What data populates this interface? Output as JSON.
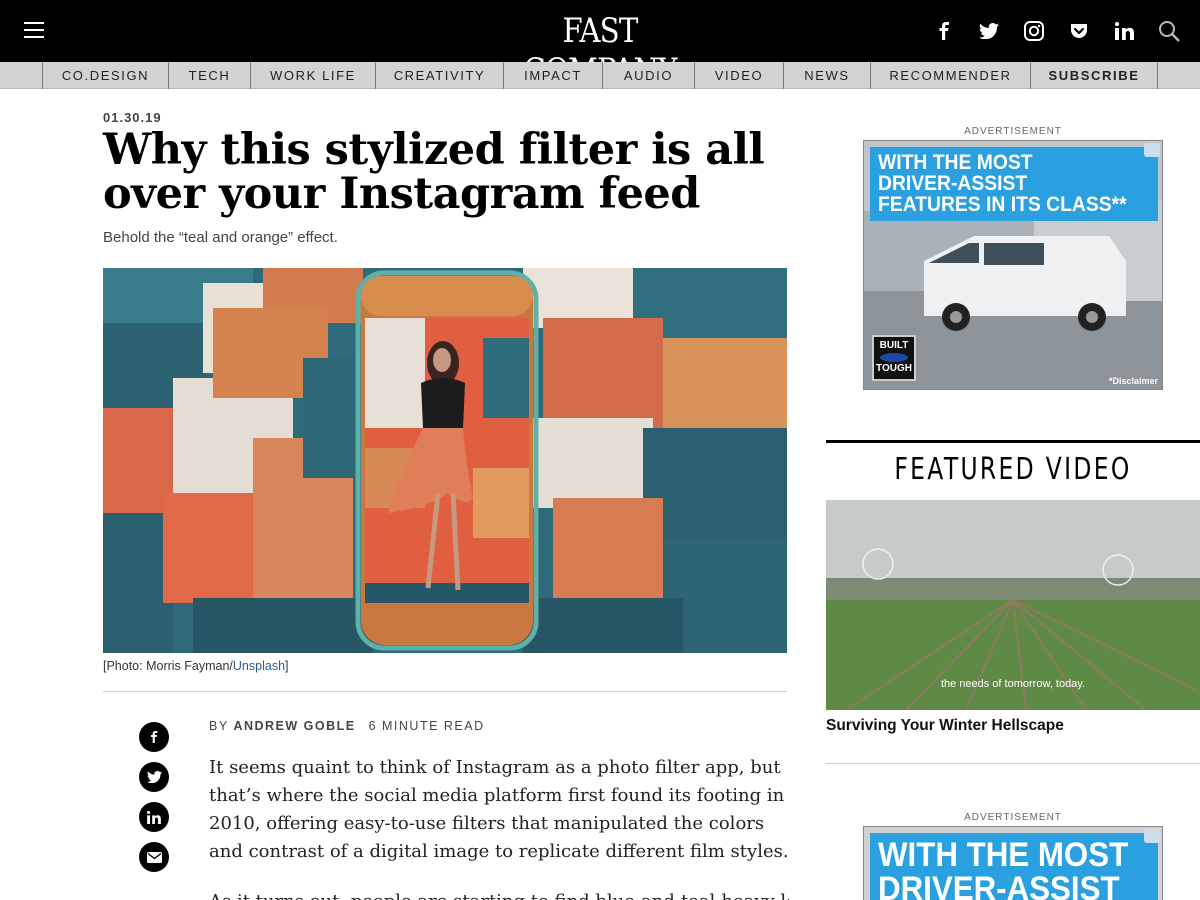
{
  "header": {
    "logo": "FAST COMPANY",
    "menu_icon": "hamburger-menu-icon",
    "social": [
      "facebook-icon",
      "twitter-icon",
      "instagram-icon",
      "pocket-icon",
      "linkedin-icon"
    ],
    "search_icon": "search-icon"
  },
  "nav": {
    "items": [
      {
        "label": "CO.DESIGN"
      },
      {
        "label": "TECH"
      },
      {
        "label": "WORK LIFE"
      },
      {
        "label": "CREATIVITY"
      },
      {
        "label": "IMPACT"
      },
      {
        "label": "AUDIO"
      },
      {
        "label": "VIDEO"
      },
      {
        "label": "NEWS"
      },
      {
        "label": "RECOMMENDER"
      },
      {
        "label": "SUBSCRIBE"
      }
    ]
  },
  "article": {
    "date": "01.30.19",
    "headline": "Why this stylized filter is all over your Instagram feed",
    "dek": "Behold the “teal and orange” effect.",
    "caption_prefix": "[Photo: Morris Fayman/",
    "caption_link": "Unsplash",
    "caption_suffix": "]",
    "byline_prefix": "BY",
    "author": "ANDREW GOBLE",
    "read_time": "6 MINUTE READ",
    "paragraph1": "It seems quaint to think of Instagram as a photo filter app, but that’s where the social media platform first found its footing in 2010, offering easy-to-use filters that manipulated the colors and contrast of a digital image to replicate different film styles.",
    "paragraph2": "As it turns out, people are starting to find blue-and-teal-heavy look"
  },
  "share": [
    "facebook-icon",
    "twitter-icon",
    "linkedin-icon",
    "email-icon"
  ],
  "sidebar": {
    "ad_label": "ADVERTISEMENT",
    "ad": {
      "line1": "WITH THE MOST",
      "line2": "DRIVER-ASSIST",
      "line3": "FEATURES IN ITS CLASS**",
      "badge_top": "BUILT",
      "badge_bottom": "TOUGH",
      "disclaimer": "*Disclaimer"
    },
    "featured_video": {
      "title": "FEATURED VIDEO",
      "subtitle_overlay": "the needs of tomorrow, today.",
      "caption": "Surviving Your Winter Hellscape"
    },
    "ad2_label": "ADVERTISEMENT",
    "ad2": {
      "line1": "WITH THE MOST",
      "line2": "DRIVER-ASSIST"
    }
  },
  "colors": {
    "header_bg": "#000000",
    "nav_bg": "#d3d3d3",
    "ad_blue": "#2aa0e0",
    "teal": "#2f6a7a",
    "orange": "#d9684a"
  }
}
